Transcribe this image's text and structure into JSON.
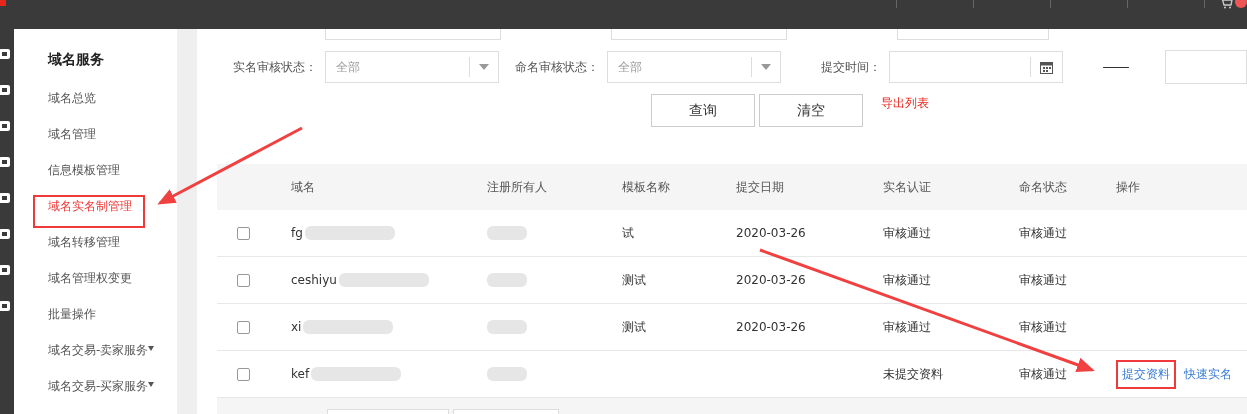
{
  "sidebar": {
    "title": "域名服务",
    "items": [
      {
        "label": "域名总览",
        "selected": false,
        "caret": false
      },
      {
        "label": "域名管理",
        "selected": false,
        "caret": false
      },
      {
        "label": "信息模板管理",
        "selected": false,
        "caret": false
      },
      {
        "label": "域名实名制管理",
        "selected": true,
        "caret": false
      },
      {
        "label": "域名转移管理",
        "selected": false,
        "caret": false
      },
      {
        "label": "域名管理权变更",
        "selected": false,
        "caret": false
      },
      {
        "label": "批量操作",
        "selected": false,
        "caret": false
      },
      {
        "label": "域名交易-卖家服务",
        "selected": false,
        "caret": true
      },
      {
        "label": "域名交易-买家服务",
        "selected": false,
        "caret": true
      }
    ]
  },
  "filters": [
    {
      "label": "实名审核状态：",
      "kind": "select",
      "value": "全部"
    },
    {
      "label": "命名审核状态：",
      "kind": "select",
      "value": "全部"
    },
    {
      "label": "提交时间：",
      "kind": "date"
    }
  ],
  "buttons": [
    "查询",
    "清空"
  ],
  "export_link": "导出列表",
  "table": {
    "columns": [
      "",
      "域名",
      "注册所有人",
      "模板名称",
      "提交日期",
      "实名认证",
      "命名状态",
      "操作"
    ],
    "rows": [
      {
        "checked": false,
        "domain": "fg",
        "template": "试",
        "date": "2020-03-26",
        "verify": "审核通过",
        "naming": "审核通过",
        "actions": []
      },
      {
        "checked": false,
        "domain": "ceshiyu",
        "template": "测试",
        "date": "2020-03-26",
        "verify": "审核通过",
        "naming": "审核通过",
        "actions": []
      },
      {
        "checked": false,
        "domain": "xi",
        "template": "测试",
        "date": "2020-03-26",
        "verify": "审核通过",
        "naming": "审核通过",
        "actions": []
      },
      {
        "checked": false,
        "domain": "kef",
        "template": "",
        "date": "",
        "verify": "未提交资料",
        "naming": "审核通过",
        "actions": [
          "提交资料",
          "快速实名"
        ]
      }
    ]
  }
}
